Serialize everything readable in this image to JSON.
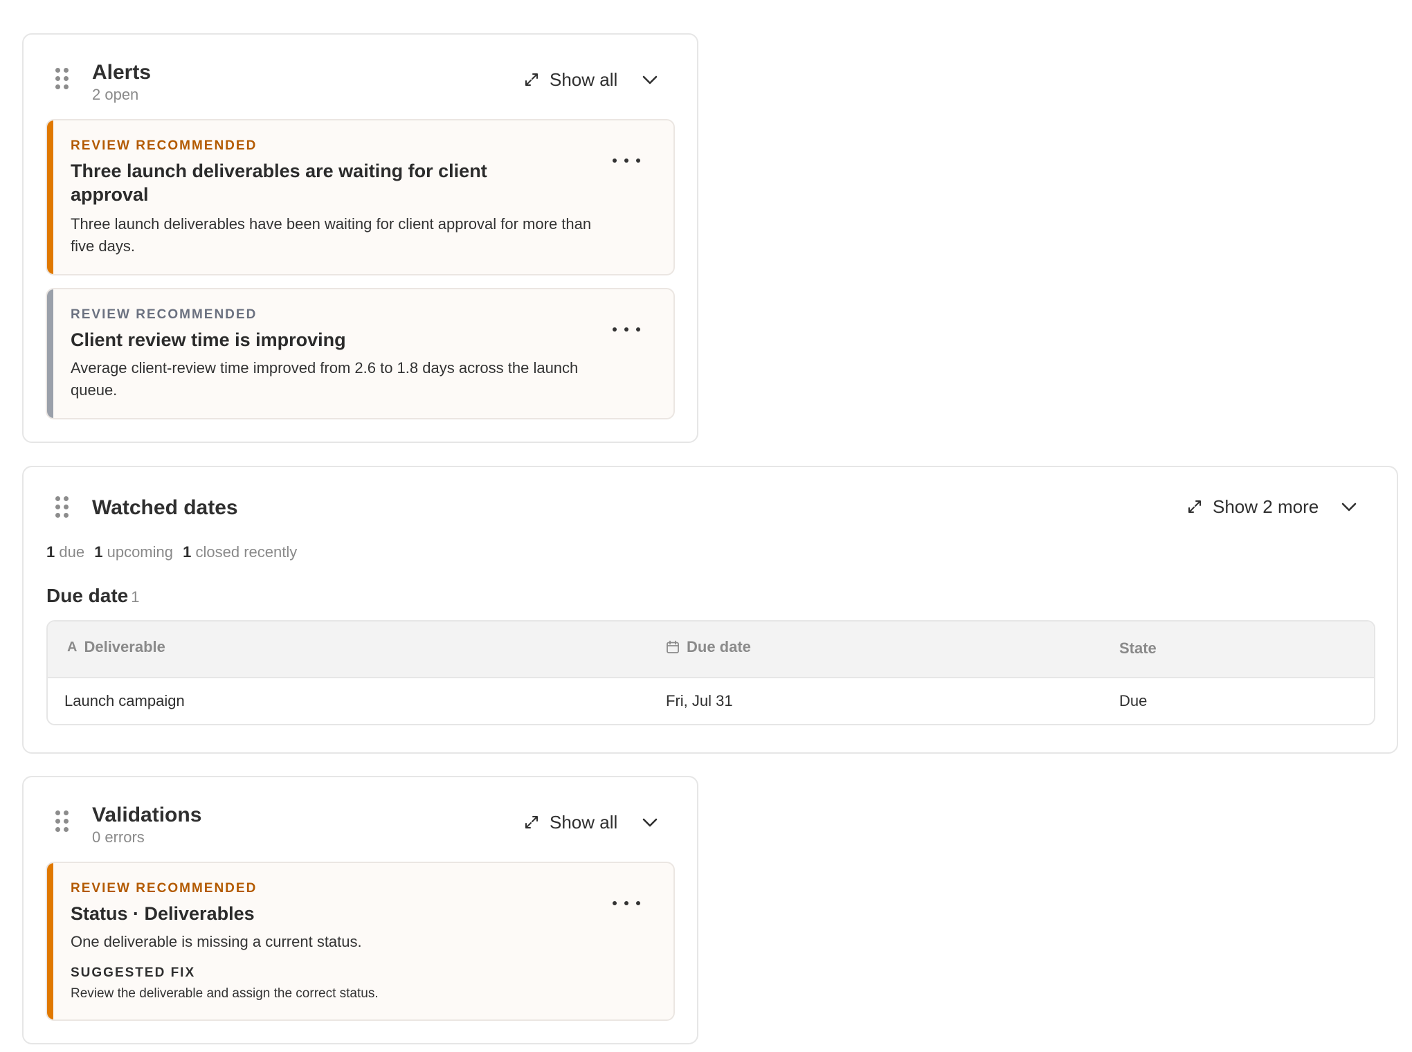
{
  "alerts": {
    "title": "Alerts",
    "subtitle": "2 open",
    "show_label": "Show all",
    "cards": [
      {
        "kicker": "REVIEW RECOMMENDED",
        "kicker_color": "#b35a00",
        "accent_color": "#e07800",
        "title": "Three launch deliverables are waiting for client approval",
        "body": "Three launch deliverables have been waiting for client approval for more than five days."
      },
      {
        "kicker": "REVIEW RECOMMENDED",
        "kicker_color": "#6b7180",
        "accent_color": "#9aa0aa",
        "title": "Client review time is improving",
        "body": "Average client-review time improved from 2.6 to 1.8 days across the launch queue."
      }
    ]
  },
  "watched_dates": {
    "title": "Watched dates",
    "show_label": "Show 2 more",
    "summary": {
      "due_count": "1",
      "due_label": "due",
      "upcoming_count": "1",
      "upcoming_label": "upcoming",
      "closed_count": "1",
      "closed_label": "closed recently"
    },
    "section": {
      "title": "Due date",
      "count": "1"
    },
    "table": {
      "columns": [
        {
          "label": "Deliverable",
          "icon": "text-type-icon"
        },
        {
          "label": "Due date",
          "icon": "calendar-icon"
        },
        {
          "label": "State",
          "icon": ""
        }
      ],
      "rows": [
        [
          "Launch campaign",
          "Fri, Jul 31",
          "Due"
        ]
      ]
    }
  },
  "validations": {
    "title": "Validations",
    "subtitle": "0 errors",
    "show_label": "Show all",
    "card": {
      "kicker": "REVIEW RECOMMENDED",
      "kicker_color": "#b35a00",
      "accent_color": "#e07800",
      "title": "Status · Deliverables",
      "body": "One deliverable is missing a current status.",
      "fix_label": "SUGGESTED FIX",
      "fix_text": "Review the deliverable and assign the correct status."
    }
  },
  "icons": {
    "drag": "drag-handle-icon",
    "expand": "expand-icon",
    "chevron": "chevron-down-icon",
    "more": "more-options-icon"
  },
  "colors": {
    "border": "#e6e6e6",
    "card_bg": "#fdfaf7",
    "muted_text": "#8a8a8a",
    "header_bg": "#f3f3f3"
  }
}
